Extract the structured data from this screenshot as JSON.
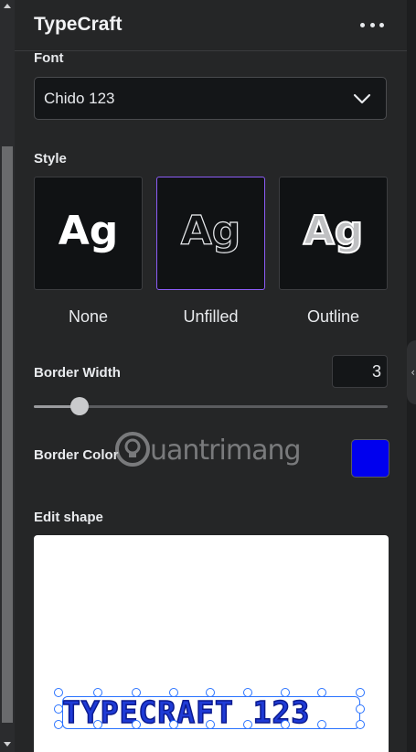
{
  "app": {
    "title": "TypeCraft"
  },
  "font": {
    "label": "Font",
    "selected": "Chido 123"
  },
  "style": {
    "label": "Style",
    "options": [
      {
        "preview": "Ag",
        "label": "None"
      },
      {
        "preview": "Ag",
        "label": "Unfilled",
        "selected": true
      },
      {
        "preview": "Ag",
        "label": "Outline"
      }
    ]
  },
  "border_width": {
    "label": "Border Width",
    "value": "3",
    "slider_fraction": 0.13
  },
  "border_color": {
    "label": "Border Color",
    "value": "#0000ee"
  },
  "edit_shape": {
    "label": "Edit shape",
    "preview_text": "TYPECRAFT 123"
  },
  "watermark": {
    "text": "uantrimang"
  },
  "icons": [
    "more-options-icon",
    "chevron-down-icon",
    "collapse-panel-icon",
    "scroll-up-icon",
    "scroll-down-icon",
    "lightbulb-icon"
  ]
}
